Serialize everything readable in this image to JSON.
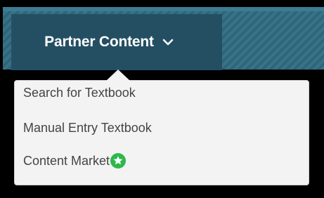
{
  "partner_menu": {
    "label": "Partner Content",
    "items": [
      {
        "label": "Search for Textbook"
      },
      {
        "label": "Manual Entry Textbook"
      },
      {
        "label": "Content Market"
      }
    ]
  },
  "colors": {
    "toolbar_bg": "#2f6b82",
    "menu_button_bg": "#244f63",
    "dropdown_bg": "#f3f3f3",
    "badge_green": "#2eb84b"
  },
  "icons": {
    "menu_chevron": "chevron-down-icon",
    "content_market_badge": "star-badge-icon"
  }
}
